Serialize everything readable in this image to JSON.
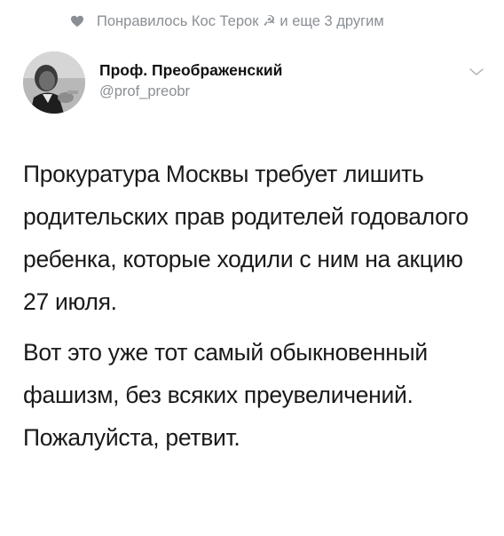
{
  "social_context": {
    "icon": "heart-icon",
    "text": "Понравилось Кос Терок ☭ и еще 3 другим"
  },
  "author": {
    "display_name": "Проф. Преображенский",
    "handle": "@prof_preobr",
    "avatar": "avatar-photo"
  },
  "tweet": {
    "paragraphs": [
      "Прокуратура Москвы требует лишить родительских прав родителей годовалого ребенка, которые ходили с ним на акцию 27 июля.",
      "Вот это уже тот самый обыкновенный фашизм, без всяких преувеличений.",
      "Пожалуйста, ретвит."
    ]
  },
  "colors": {
    "secondary_text": "#8a8f95",
    "primary_text": "#1a1a1a"
  }
}
